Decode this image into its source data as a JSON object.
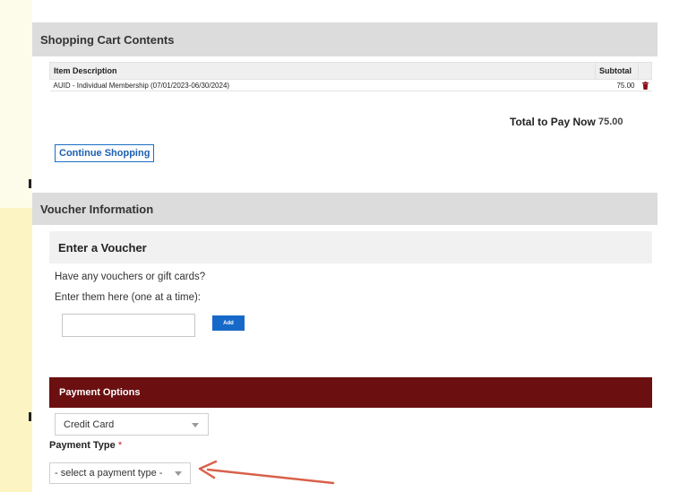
{
  "cart": {
    "header": "Shopping Cart Contents",
    "columns": {
      "description": "Item Description",
      "subtotal": "Subtotal"
    },
    "rows": [
      {
        "description": "AUID - Individual Membership (07/01/2023-06/30/2024)",
        "subtotal": "75.00"
      }
    ],
    "total_label": "Total to Pay Now",
    "total_value": "75.00",
    "continue_label": "Continue Shopping"
  },
  "voucher": {
    "header": "Voucher Information",
    "subheader": "Enter a Voucher",
    "line1": "Have any vouchers or gift cards?",
    "line2": "Enter them here (one at a time):",
    "input_value": "",
    "add_label": "Add"
  },
  "payment": {
    "header": "Payment Options",
    "method_selected": "Credit Card",
    "type_label": "Payment Type",
    "required_mark": "*",
    "type_selected": "- select a payment type -"
  },
  "colors": {
    "payment_bar": "#6b0f10",
    "accent_blue": "#1769c9",
    "annotation_arrow": "#d9614a",
    "trash_icon": "#8b0f14"
  },
  "icons": {
    "remove_item": "trash-icon",
    "dropdown": "chevron-down-icon",
    "annotation": "arrow-left-icon"
  }
}
